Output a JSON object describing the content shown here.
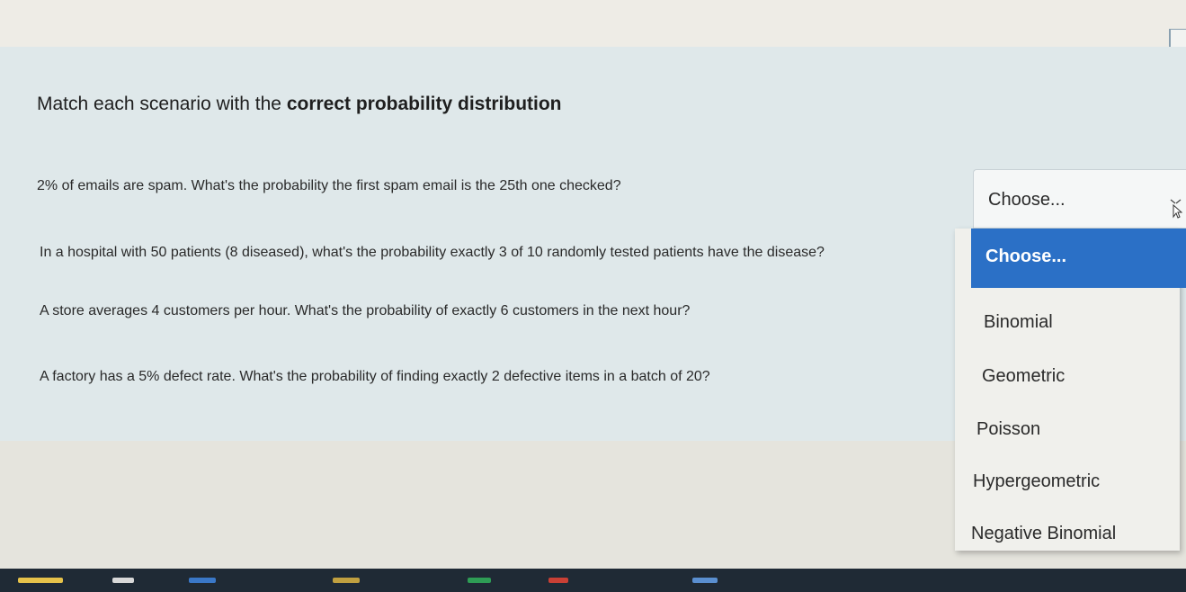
{
  "heading": {
    "prefix": "Match each scenario with the ",
    "bold": "correct probability distribution"
  },
  "questions": [
    {
      "text": "2% of emails are spam. What's the probability the first spam email is the 25th one checked?"
    },
    {
      "text": "In a hospital with 50 patients (8 diseased), what's the probability exactly 3 of 10 randomly tested patients have the disease?"
    },
    {
      "text": "A store averages 4 customers per hour. What's the probability of exactly 6 customers in the next hour?"
    },
    {
      "text": "A factory has a 5% defect rate. What's the probability of finding exactly 2 defective items in a batch of 20?"
    }
  ],
  "select": {
    "current_value": "Choose..."
  },
  "dropdown": {
    "options": [
      "Choose...",
      "Binomial",
      "Geometric",
      "Poisson",
      "Hypergeometric",
      "Negative Binomial"
    ],
    "highlighted_index": 0,
    "highlight_color": "#2b70c6"
  },
  "icons": {
    "cursor": "mouse-pointer-icon"
  }
}
